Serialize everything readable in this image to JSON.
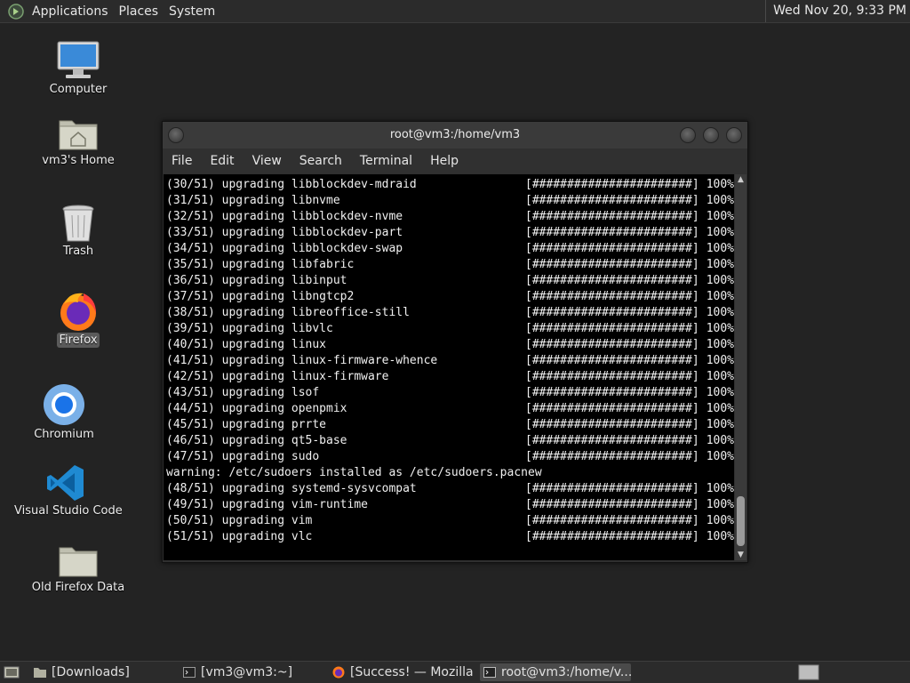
{
  "top_panel": {
    "menus": [
      "Applications",
      "Places",
      "System"
    ],
    "clock": "Wed Nov 20,  9:33 PM"
  },
  "desktop": {
    "icons": [
      {
        "label": "Computer",
        "icon": "computer-icon"
      },
      {
        "label": "vm3's Home",
        "icon": "home-folder-icon"
      },
      {
        "label": "Trash",
        "icon": "trash-icon"
      },
      {
        "label": "Firefox",
        "icon": "firefox-icon"
      },
      {
        "label": "Chromium",
        "icon": "chromium-icon"
      },
      {
        "label": "Visual Studio Code",
        "icon": "vscode-icon"
      },
      {
        "label": "Old Firefox Data",
        "icon": "folder-icon"
      }
    ]
  },
  "terminal": {
    "title": "root@vm3:/home/vm3",
    "menu": [
      "File",
      "Edit",
      "View",
      "Search",
      "Terminal",
      "Help"
    ],
    "progress_bar": "[#######################]",
    "lines": [
      {
        "text": "(30/51) upgrading libblockdev-mdraid",
        "pct": "100%"
      },
      {
        "text": "(31/51) upgrading libnvme",
        "pct": "100%"
      },
      {
        "text": "(32/51) upgrading libblockdev-nvme",
        "pct": "100%"
      },
      {
        "text": "(33/51) upgrading libblockdev-part",
        "pct": "100%"
      },
      {
        "text": "(34/51) upgrading libblockdev-swap",
        "pct": "100%"
      },
      {
        "text": "(35/51) upgrading libfabric",
        "pct": "100%"
      },
      {
        "text": "(36/51) upgrading libinput",
        "pct": "100%"
      },
      {
        "text": "(37/51) upgrading libngtcp2",
        "pct": "100%"
      },
      {
        "text": "(38/51) upgrading libreoffice-still",
        "pct": "100%"
      },
      {
        "text": "(39/51) upgrading libvlc",
        "pct": "100%"
      },
      {
        "text": "(40/51) upgrading linux",
        "pct": "100%"
      },
      {
        "text": "(41/51) upgrading linux-firmware-whence",
        "pct": "100%"
      },
      {
        "text": "(42/51) upgrading linux-firmware",
        "pct": "100%"
      },
      {
        "text": "(43/51) upgrading lsof",
        "pct": "100%"
      },
      {
        "text": "(44/51) upgrading openpmix",
        "pct": "100%"
      },
      {
        "text": "(45/51) upgrading prrte",
        "pct": "100%"
      },
      {
        "text": "(46/51) upgrading qt5-base",
        "pct": "100%"
      },
      {
        "text": "(47/51) upgrading sudo",
        "pct": "100%"
      },
      {
        "text": "warning: /etc/sudoers installed as /etc/sudoers.pacnew",
        "pct": ""
      },
      {
        "text": "(48/51) upgrading systemd-sysvcompat",
        "pct": "100%"
      },
      {
        "text": "(49/51) upgrading vim-runtime",
        "pct": "100%"
      },
      {
        "text": "(50/51) upgrading vim",
        "pct": "100%"
      },
      {
        "text": "(51/51) upgrading vlc",
        "pct": "100%"
      }
    ]
  },
  "taskbar": {
    "tasks": [
      {
        "label": "[Downloads]",
        "icon": "folder-icon",
        "active": false
      },
      {
        "label": "[vm3@vm3:~]",
        "icon": "terminal-icon",
        "active": false
      },
      {
        "label": "[Success! — Mozilla ...",
        "icon": "firefox-icon",
        "active": false
      },
      {
        "label": "root@vm3:/home/v...",
        "icon": "terminal-icon",
        "active": true
      }
    ]
  },
  "colors": {
    "desktop_bg": "#232323",
    "panel_bg": "#2b2b2b",
    "terminal_bg": "#000000",
    "terminal_fg": "#f0f0f0"
  }
}
